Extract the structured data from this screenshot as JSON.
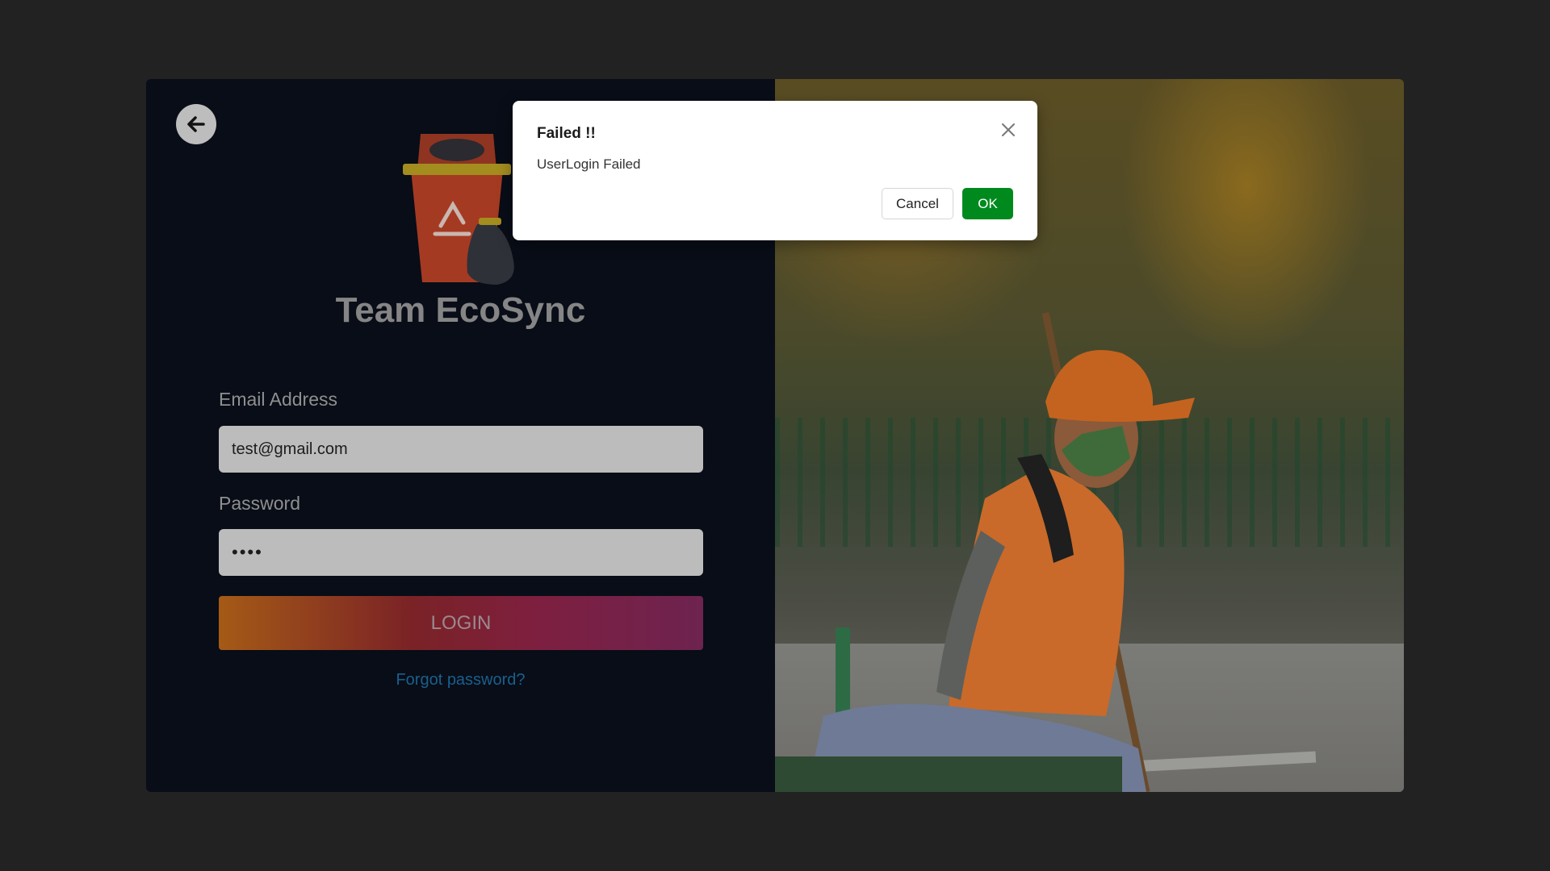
{
  "brand": {
    "title": "Team EcoSync"
  },
  "form": {
    "email_label": "Email Address",
    "email_value": "test@gmail.com",
    "password_label": "Password",
    "password_value": "••••",
    "login_label": "LOGIN",
    "forgot_label": "Forgot password?"
  },
  "dialog": {
    "title": "Failed !!",
    "message": "UserLogin Failed",
    "cancel_label": "Cancel",
    "ok_label": "OK"
  },
  "icons": {
    "back": "arrow-left-icon",
    "close": "close-icon",
    "logo": "recycle-bin-icon"
  },
  "colors": {
    "ok_button": "#008a1e",
    "forgot_link": "#1a5f8d",
    "panel_bg": "#080d17"
  }
}
